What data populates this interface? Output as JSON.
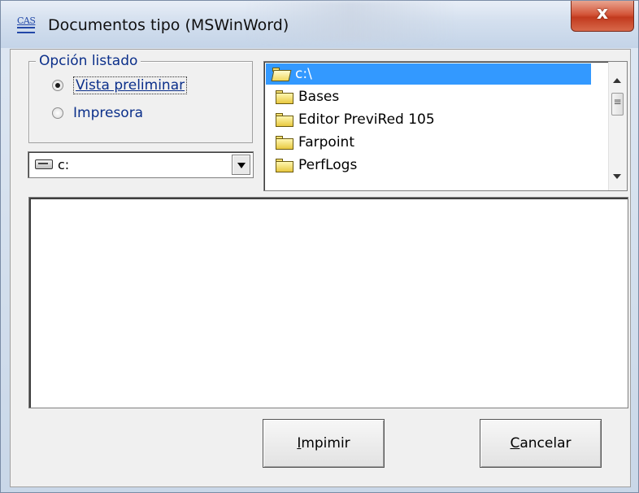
{
  "window": {
    "icon_text": "CAS",
    "title": "Documentos tipo (MSWinWord)",
    "close_glyph": "x"
  },
  "options_group": {
    "legend": "Opción listado",
    "options": [
      {
        "label": "Vista preliminar",
        "checked": true
      },
      {
        "label": "Impresora",
        "checked": false
      }
    ]
  },
  "drive_select": {
    "value": "c:",
    "icon": "drive-icon"
  },
  "directory_list": {
    "items": [
      {
        "label": "c:\\",
        "selected": true,
        "icon": "open-folder-icon"
      },
      {
        "label": "Bases",
        "selected": false,
        "icon": "folder-icon"
      },
      {
        "label": "Editor PreviRed 105",
        "selected": false,
        "icon": "folder-icon"
      },
      {
        "label": "Farpoint",
        "selected": false,
        "icon": "folder-icon"
      },
      {
        "label": "PerfLogs",
        "selected": false,
        "icon": "folder-icon"
      }
    ]
  },
  "buttons": {
    "print": {
      "pre": "",
      "accel": "I",
      "post": "mpimir"
    },
    "cancel": {
      "pre": "",
      "accel": "C",
      "post": "ancelar"
    }
  },
  "colors": {
    "selection": "#3399ff",
    "label_text": "#0b2f8a",
    "close_button": "#c23a1e"
  }
}
